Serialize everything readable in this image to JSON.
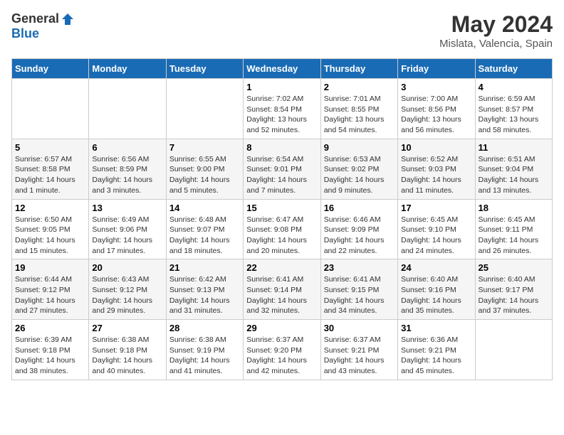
{
  "logo": {
    "text_general": "General",
    "text_blue": "Blue"
  },
  "header": {
    "title": "May 2024",
    "subtitle": "Mislata, Valencia, Spain"
  },
  "columns": [
    "Sunday",
    "Monday",
    "Tuesday",
    "Wednesday",
    "Thursday",
    "Friday",
    "Saturday"
  ],
  "weeks": [
    {
      "days": [
        {
          "num": "",
          "info": ""
        },
        {
          "num": "",
          "info": ""
        },
        {
          "num": "",
          "info": ""
        },
        {
          "num": "1",
          "info": "Sunrise: 7:02 AM\nSunset: 8:54 PM\nDaylight: 13 hours and 52 minutes."
        },
        {
          "num": "2",
          "info": "Sunrise: 7:01 AM\nSunset: 8:55 PM\nDaylight: 13 hours and 54 minutes."
        },
        {
          "num": "3",
          "info": "Sunrise: 7:00 AM\nSunset: 8:56 PM\nDaylight: 13 hours and 56 minutes."
        },
        {
          "num": "4",
          "info": "Sunrise: 6:59 AM\nSunset: 8:57 PM\nDaylight: 13 hours and 58 minutes."
        }
      ]
    },
    {
      "days": [
        {
          "num": "5",
          "info": "Sunrise: 6:57 AM\nSunset: 8:58 PM\nDaylight: 14 hours and 1 minute."
        },
        {
          "num": "6",
          "info": "Sunrise: 6:56 AM\nSunset: 8:59 PM\nDaylight: 14 hours and 3 minutes."
        },
        {
          "num": "7",
          "info": "Sunrise: 6:55 AM\nSunset: 9:00 PM\nDaylight: 14 hours and 5 minutes."
        },
        {
          "num": "8",
          "info": "Sunrise: 6:54 AM\nSunset: 9:01 PM\nDaylight: 14 hours and 7 minutes."
        },
        {
          "num": "9",
          "info": "Sunrise: 6:53 AM\nSunset: 9:02 PM\nDaylight: 14 hours and 9 minutes."
        },
        {
          "num": "10",
          "info": "Sunrise: 6:52 AM\nSunset: 9:03 PM\nDaylight: 14 hours and 11 minutes."
        },
        {
          "num": "11",
          "info": "Sunrise: 6:51 AM\nSunset: 9:04 PM\nDaylight: 14 hours and 13 minutes."
        }
      ]
    },
    {
      "days": [
        {
          "num": "12",
          "info": "Sunrise: 6:50 AM\nSunset: 9:05 PM\nDaylight: 14 hours and 15 minutes."
        },
        {
          "num": "13",
          "info": "Sunrise: 6:49 AM\nSunset: 9:06 PM\nDaylight: 14 hours and 17 minutes."
        },
        {
          "num": "14",
          "info": "Sunrise: 6:48 AM\nSunset: 9:07 PM\nDaylight: 14 hours and 18 minutes."
        },
        {
          "num": "15",
          "info": "Sunrise: 6:47 AM\nSunset: 9:08 PM\nDaylight: 14 hours and 20 minutes."
        },
        {
          "num": "16",
          "info": "Sunrise: 6:46 AM\nSunset: 9:09 PM\nDaylight: 14 hours and 22 minutes."
        },
        {
          "num": "17",
          "info": "Sunrise: 6:45 AM\nSunset: 9:10 PM\nDaylight: 14 hours and 24 minutes."
        },
        {
          "num": "18",
          "info": "Sunrise: 6:45 AM\nSunset: 9:11 PM\nDaylight: 14 hours and 26 minutes."
        }
      ]
    },
    {
      "days": [
        {
          "num": "19",
          "info": "Sunrise: 6:44 AM\nSunset: 9:12 PM\nDaylight: 14 hours and 27 minutes."
        },
        {
          "num": "20",
          "info": "Sunrise: 6:43 AM\nSunset: 9:12 PM\nDaylight: 14 hours and 29 minutes."
        },
        {
          "num": "21",
          "info": "Sunrise: 6:42 AM\nSunset: 9:13 PM\nDaylight: 14 hours and 31 minutes."
        },
        {
          "num": "22",
          "info": "Sunrise: 6:41 AM\nSunset: 9:14 PM\nDaylight: 14 hours and 32 minutes."
        },
        {
          "num": "23",
          "info": "Sunrise: 6:41 AM\nSunset: 9:15 PM\nDaylight: 14 hours and 34 minutes."
        },
        {
          "num": "24",
          "info": "Sunrise: 6:40 AM\nSunset: 9:16 PM\nDaylight: 14 hours and 35 minutes."
        },
        {
          "num": "25",
          "info": "Sunrise: 6:40 AM\nSunset: 9:17 PM\nDaylight: 14 hours and 37 minutes."
        }
      ]
    },
    {
      "days": [
        {
          "num": "26",
          "info": "Sunrise: 6:39 AM\nSunset: 9:18 PM\nDaylight: 14 hours and 38 minutes."
        },
        {
          "num": "27",
          "info": "Sunrise: 6:38 AM\nSunset: 9:18 PM\nDaylight: 14 hours and 40 minutes."
        },
        {
          "num": "28",
          "info": "Sunrise: 6:38 AM\nSunset: 9:19 PM\nDaylight: 14 hours and 41 minutes."
        },
        {
          "num": "29",
          "info": "Sunrise: 6:37 AM\nSunset: 9:20 PM\nDaylight: 14 hours and 42 minutes."
        },
        {
          "num": "30",
          "info": "Sunrise: 6:37 AM\nSunset: 9:21 PM\nDaylight: 14 hours and 43 minutes."
        },
        {
          "num": "31",
          "info": "Sunrise: 6:36 AM\nSunset: 9:21 PM\nDaylight: 14 hours and 45 minutes."
        },
        {
          "num": "",
          "info": ""
        }
      ]
    }
  ]
}
